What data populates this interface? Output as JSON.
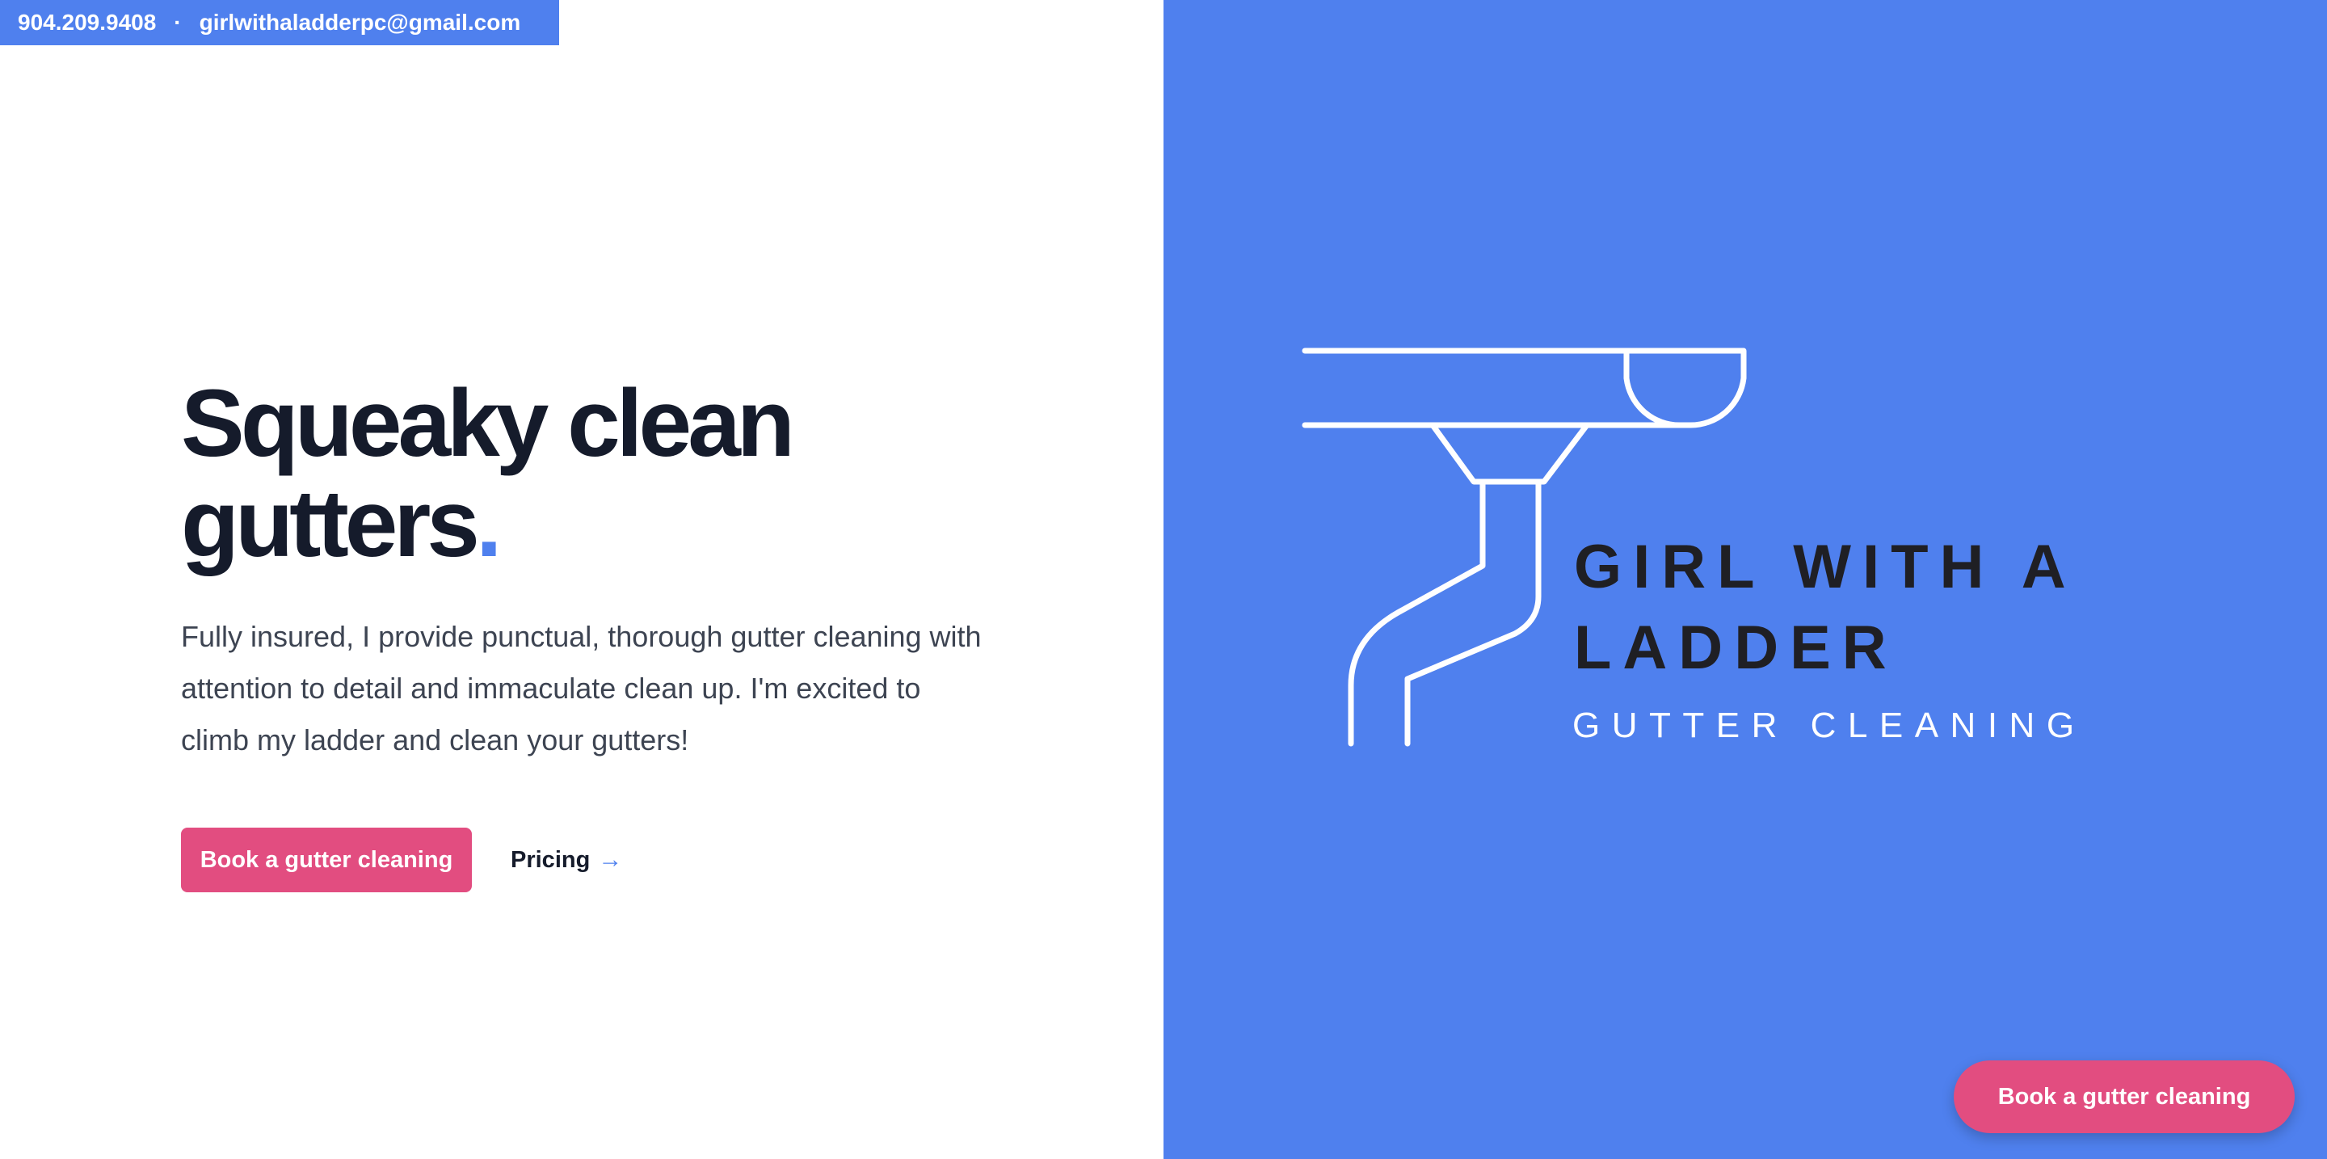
{
  "contact": {
    "phone": "904.209.9408",
    "separator": "·",
    "email": "girlwithaladderpc@gmail.com"
  },
  "hero": {
    "headline_line1": "Squeaky clean",
    "headline_line2": "gutters",
    "headline_dot": ".",
    "description": "Fully insured, I provide punctual, thorough gutter cleaning with attention to detail and immaculate clean up. I'm excited to climb my ladder and clean your gutters!",
    "book_button_label": "Book a gutter cleaning",
    "pricing_link_label": "Pricing",
    "pricing_arrow": "→"
  },
  "logo": {
    "title": "GIRL WITH A LADDER",
    "subtitle": "GUTTER CLEANING",
    "icon": "gutter-downspout-icon"
  },
  "floating_cta": {
    "label": "Book a gutter cleaning"
  },
  "colors": {
    "accent_blue": "#4f80ee",
    "button_pink": "#e24d80",
    "heading_dark": "#151b2b",
    "body_text": "#3d4452",
    "logo_title": "#1f1f24"
  }
}
